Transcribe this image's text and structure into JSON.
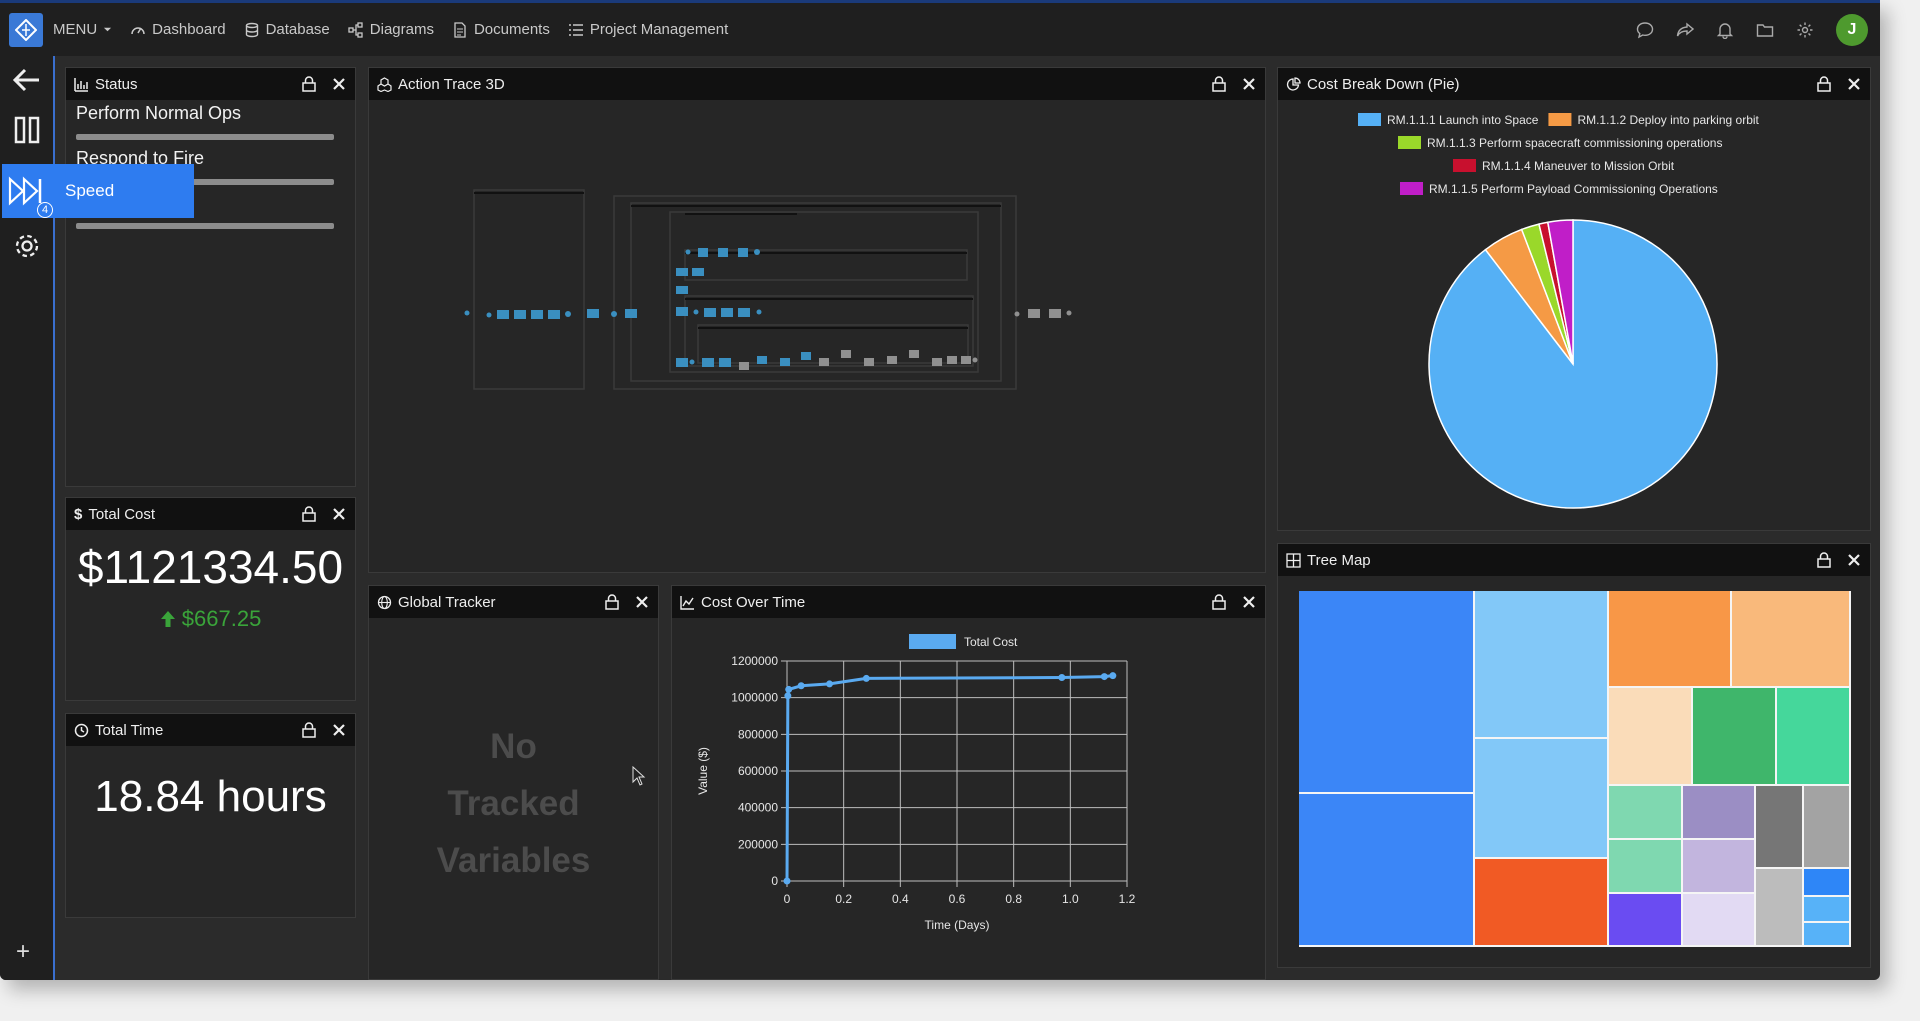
{
  "nav": {
    "menu_label": "MENU",
    "items": [
      "Dashboard",
      "Database",
      "Diagrams",
      "Documents",
      "Project Management"
    ],
    "user_initial": "J"
  },
  "rail": {
    "speed_label": "Speed",
    "speed_badge": "4",
    "add_label": "+"
  },
  "panels": {
    "status": {
      "title": "Status",
      "items": [
        "Perform Normal Ops",
        "Respond to Fire"
      ]
    },
    "total_cost": {
      "title": "Total Cost",
      "value": "$1121334.50",
      "delta": "$667.25",
      "delta_color": "#3aa43a"
    },
    "total_time": {
      "title": "Total Time",
      "value": "18.84 hours"
    },
    "action_trace": {
      "title": "Action Trace 3D"
    },
    "global_tracker": {
      "title": "Global Tracker",
      "empty_line1": "No",
      "empty_line2": "Tracked",
      "empty_line3": "Variables"
    },
    "cost_over_time": {
      "title": "Cost Over Time"
    },
    "cost_breakdown": {
      "title": "Cost Break Down (Pie)"
    },
    "tree_map": {
      "title": "Tree Map"
    }
  },
  "chart_data": [
    {
      "type": "line",
      "title": "",
      "legend": "Total Cost",
      "xlabel": "Time (Days)",
      "ylabel": "Value ($)",
      "xlim": [
        0,
        1.2
      ],
      "ylim": [
        0,
        1200000
      ],
      "xticks": [
        "0",
        "0.2",
        "0.4",
        "0.6",
        "0.8",
        "1.0",
        "1.2"
      ],
      "yticks": [
        "0",
        "200000",
        "400000",
        "600000",
        "800000",
        "1000000",
        "1200000"
      ],
      "series": [
        {
          "name": "Total Cost",
          "color": "#5aaaf0",
          "x": [
            0,
            0.003,
            0.006,
            0.05,
            0.15,
            0.28,
            0.97,
            1.12,
            1.15
          ],
          "y": [
            0,
            1010000,
            1045000,
            1065000,
            1075000,
            1105000,
            1110000,
            1115000,
            1120000
          ]
        }
      ]
    },
    {
      "type": "pie",
      "title": "",
      "legend_placement": "top",
      "categories": [
        "RM.1.1.1 Launch into Space",
        "RM.1.1.2 Deploy into parking orbit",
        "RM.1.1.3 Perform spacecraft commissioning operations",
        "RM.1.1.4 Maneuver to Mission Orbit",
        "RM.1.1.5 Perform Payload Commissioning Operations"
      ],
      "values": [
        89.6,
        4.6,
        2.0,
        1.0,
        2.8
      ],
      "colors": [
        "#55b0f5",
        "#f59a45",
        "#9ad82a",
        "#c8102e",
        "#c01ec8"
      ]
    }
  ],
  "tree_map_colors": [
    "#3b86f7",
    "#82c8f8",
    "#f89747",
    "#f9b97b",
    "#fadcb9",
    "#3fb66b",
    "#45d79b",
    "#7fd8b0",
    "#9b8ec4",
    "#c2b5de",
    "#767676",
    "#a3a3a3",
    "#bcbcbc",
    "#6a4cf2",
    "#e2daf3",
    "#2e86f7",
    "#57b2f8",
    "#f15a24"
  ]
}
